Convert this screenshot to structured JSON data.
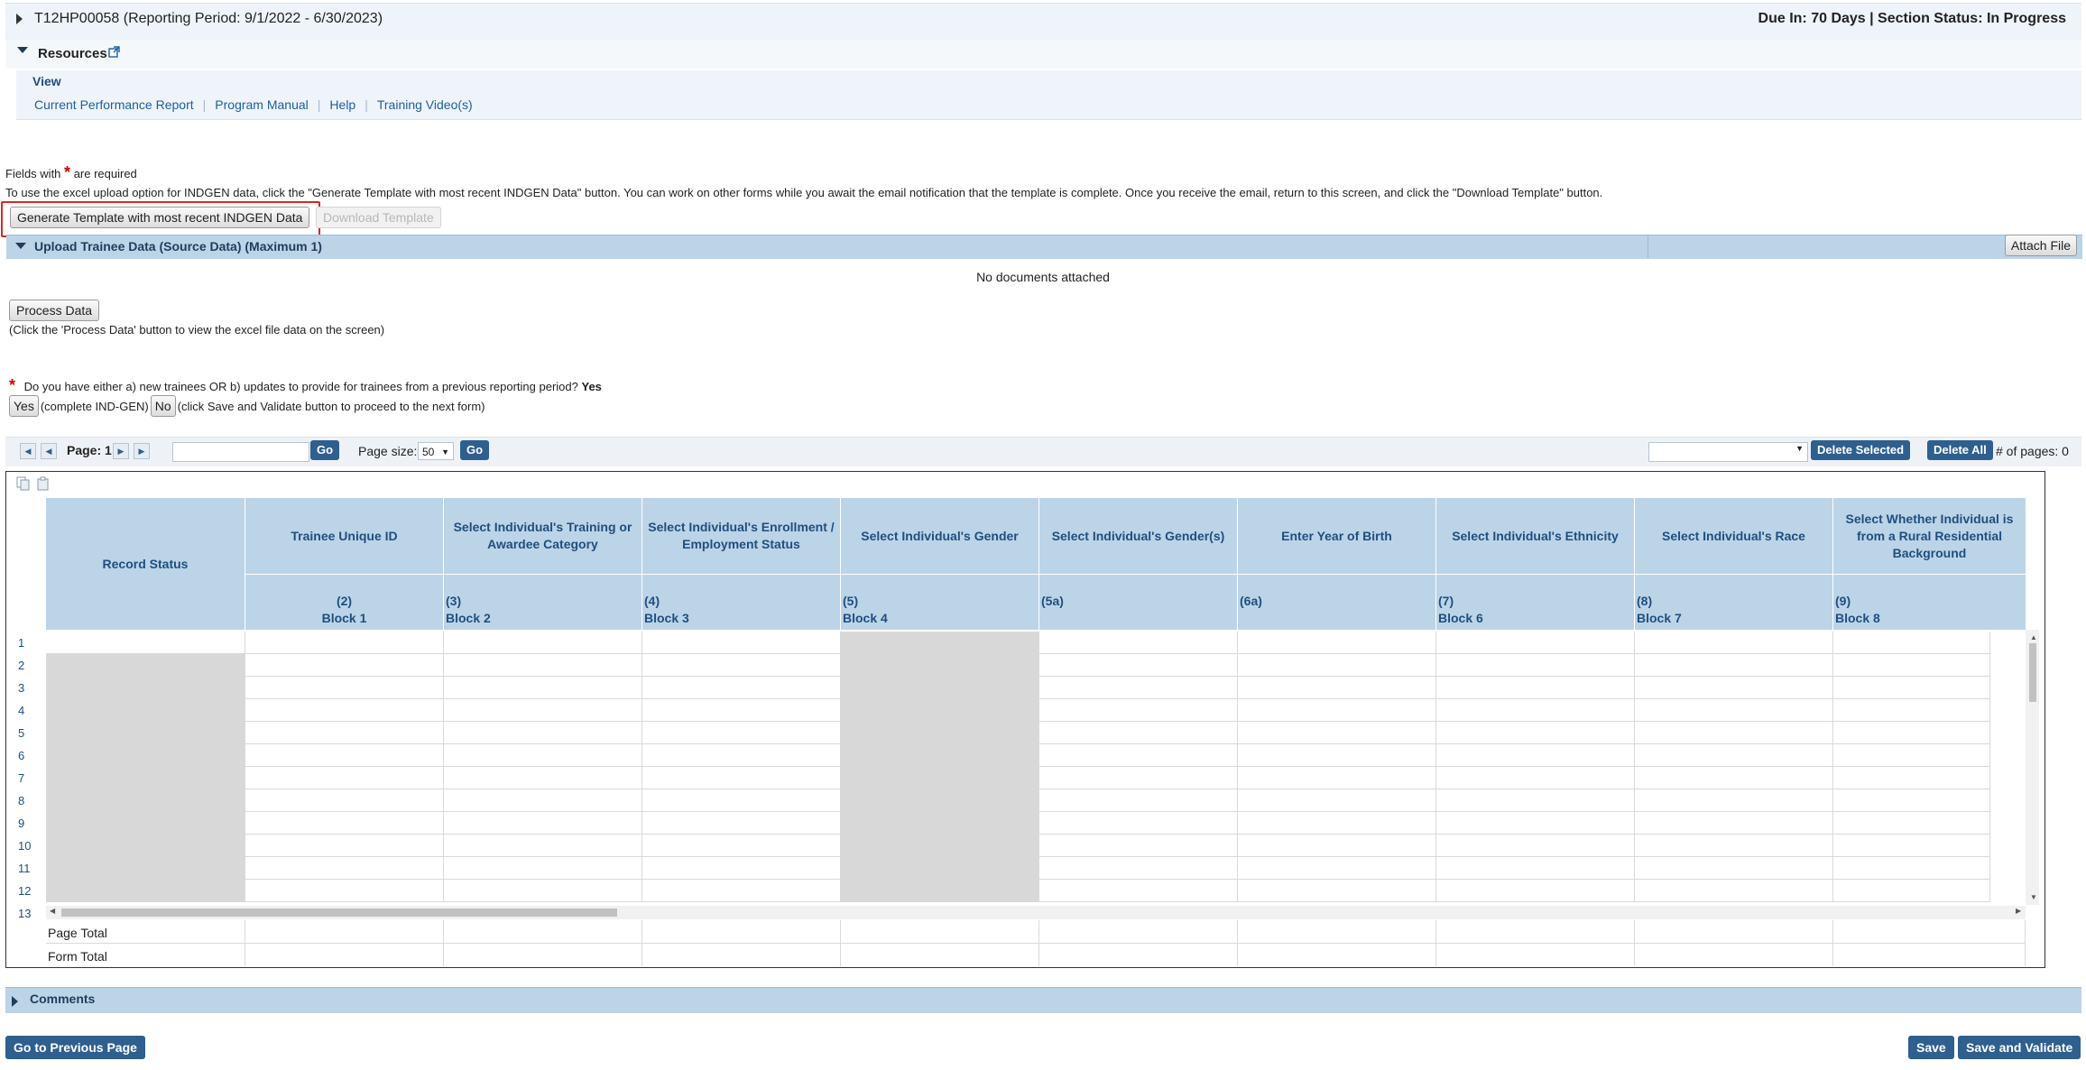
{
  "header": {
    "grant_title": "T12HP00058 (Reporting Period: 9/1/2022 - 6/30/2023)",
    "due_status": "Due In: 70 Days | Section Status: In Progress"
  },
  "resources": {
    "label": "Resources",
    "view_tab": "View",
    "links": [
      "Current Performance Report",
      "Program Manual",
      "Help",
      "Training Video(s)"
    ]
  },
  "form": {
    "required_prefix": "Fields with",
    "required_star": "*",
    "required_suffix": "are required",
    "instruction": "To use the excel upload option for INDGEN data, click the \"Generate Template with most recent INDGEN Data\" button. You can work on other forms while you await the email notification that the template is complete. Once you receive the email, return to this screen, and click the \"Download Template\" button.",
    "generate_button": "Generate Template with most recent INDGEN Data",
    "download_button": "Download Template"
  },
  "upload": {
    "title": "Upload Trainee Data (Source Data) (Maximum 1)",
    "attach_button": "Attach File",
    "no_documents": "No documents attached",
    "process_button": "Process Data",
    "process_hint": "(Click the 'Process Data' button to view the excel file data on the screen)"
  },
  "question": {
    "star": "*",
    "text": "Do you have either a) new trainees OR b) updates to provide for trainees from a previous reporting period?",
    "answer": "Yes",
    "yes_button": "Yes",
    "yes_hint": "(complete IND-GEN)",
    "no_button": "No",
    "no_hint": "(click Save and Validate button to proceed to the next form)"
  },
  "pager": {
    "page_label": "Page: 1",
    "go_label": "Go",
    "page_size_label": "Page size:",
    "page_size_value": "50",
    "go2_label": "Go",
    "delete_selected": "Delete Selected",
    "delete_all": "Delete All",
    "num_pages": "# of pages: 0"
  },
  "grid": {
    "record_status": "Record Status",
    "columns": [
      {
        "title": "Trainee Unique ID",
        "num": "(2)",
        "block": "Block 1",
        "align": "center"
      },
      {
        "title": "Select Individual's Training or Awardee Category",
        "num": "(3)",
        "block": "Block 2",
        "align": "left"
      },
      {
        "title": "Select Individual's Enrollment / Employment Status",
        "num": "(4)",
        "block": "Block 3",
        "align": "left"
      },
      {
        "title": "Select Individual's Gender",
        "num": "(5)",
        "block": "Block 4",
        "align": "left"
      },
      {
        "title": "Select Individual's Gender(s)",
        "num": "(5a)",
        "block": "",
        "align": "left"
      },
      {
        "title": "Enter Year of Birth",
        "num": "(6a)",
        "block": "",
        "align": "left"
      },
      {
        "title": "Select Individual's Ethnicity",
        "num": "(7)",
        "block": "Block 6",
        "align": "left"
      },
      {
        "title": "Select Individual's Race",
        "num": "(8)",
        "block": "Block 7",
        "align": "left"
      },
      {
        "title": "Select Whether Individual is from a Rural Residential Background",
        "num": "(9)",
        "block": "Block 8",
        "align": "left"
      }
    ],
    "row_numbers": [
      "1",
      "2",
      "3",
      "4",
      "5",
      "6",
      "7",
      "8",
      "9",
      "10",
      "11",
      "12",
      "13"
    ],
    "page_total": "Page Total",
    "form_total": "Form Total"
  },
  "comments": {
    "label": "Comments"
  },
  "footer": {
    "previous_button": "Go to Previous Page",
    "save_button": "Save",
    "save_validate_button": "Save and Validate"
  },
  "colors": {
    "header_bg": "#eef4f9",
    "section_bar": "#bcd4e8",
    "primary_button": "#2e5f8f",
    "link": "#1f5fa0",
    "required": "#cc0000",
    "highlight": "#d62828"
  }
}
